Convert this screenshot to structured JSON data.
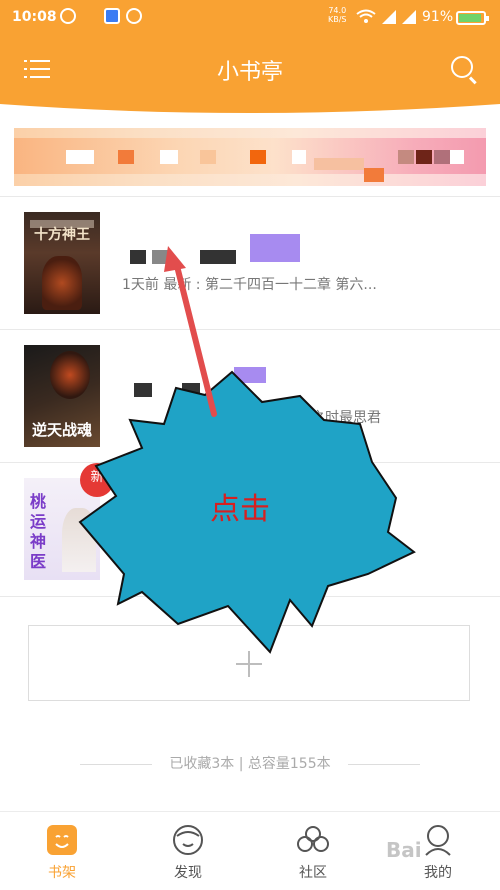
{
  "status": {
    "time": "10:08",
    "net_speed": "74.0",
    "net_unit": "KB/S",
    "battery": "91%"
  },
  "header": {
    "title": "小书亭"
  },
  "books": [
    {
      "cover_text": "十方神王",
      "meta": "1天前 最新 : 第二千四百一十二章 第六..."
    },
    {
      "cover_text": "逆天战魂",
      "meta": "苍雷之时最思君"
    },
    {
      "cover_text": "桃运神医",
      "badge": "新"
    }
  ],
  "shelf": {
    "summary": "已收藏3本 | 总容量155本"
  },
  "tabs": [
    {
      "label": "书架",
      "active": true
    },
    {
      "label": "发现"
    },
    {
      "label": "社区"
    },
    {
      "label": "我的"
    }
  ],
  "annotation": {
    "text": "点击"
  },
  "watermark": "Bai"
}
